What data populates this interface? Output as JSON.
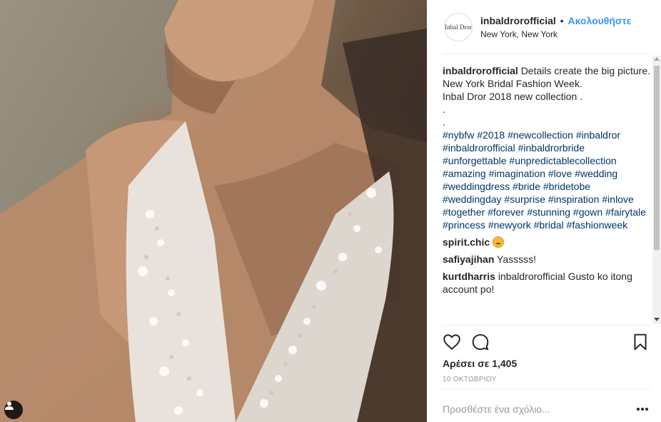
{
  "post": {
    "username": "inbaldrorofficial",
    "separator": "•",
    "follow_label": "Ακολουθήστε",
    "location": "New York, New York",
    "avatar_text": "Inbal Dror"
  },
  "caption": {
    "user": "inbaldrorofficial",
    "lines": [
      "Details create the big picture.",
      "New York Bridal Fashion Week.",
      "Inbal Dror 2018 new collection .",
      ".",
      "."
    ],
    "hashtags": [
      "#nybfw",
      "#2018",
      "#newcollection",
      "#inbaldror",
      "#inbaldrorofficial",
      "#inbaldrorbride",
      "#unforgettable",
      "#unpredictablecollection",
      "#amazing",
      "#imagination",
      "#love",
      "#wedding",
      "#weddingdress",
      "#bride",
      "#bridetobe",
      "#weddingday",
      "#surprise",
      "#inspiration",
      "#inlove",
      "#together",
      "#forever",
      "#stunning",
      "#gown",
      "#fairytale",
      "#princess",
      "#newyork",
      "#bridal",
      "#fashionweek"
    ]
  },
  "comments": [
    {
      "user": "spirit.chic",
      "text": "",
      "emoji": "smiling-face-emoji"
    },
    {
      "user": "safiyajihan",
      "text": "Yasssss!"
    },
    {
      "user": "kurtdharris",
      "text": "inbaldrorofficial Gusto ko itong account po!"
    }
  ],
  "actions": {
    "likes": "Αρέσει σε 1,405",
    "date": "10 ΟΚΤΩΒΡΙΟΥ"
  },
  "add_comment": {
    "placeholder": "Προσθέστε ένα σχόλιο..."
  },
  "icons": {
    "like": "heart-icon",
    "comment": "comment-bubble-icon",
    "save": "bookmark-icon",
    "more": "more-options-icon",
    "user_tag": "user-tag-icon"
  },
  "colors": {
    "link": "#3897f0",
    "hashtag": "#003569",
    "text": "#262626",
    "muted": "#999999"
  }
}
